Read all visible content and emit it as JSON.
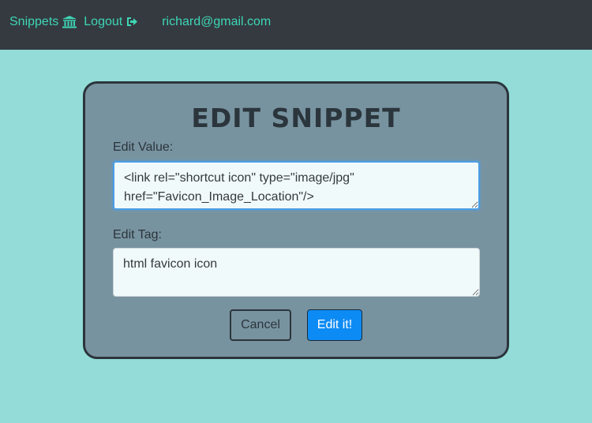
{
  "nav": {
    "snippets_label": "Snippets",
    "snippets_icon": "bank-icon",
    "logout_label": "Logout",
    "logout_icon": "sign-out-icon",
    "user_email": "richard@gmail.com"
  },
  "form": {
    "title": "EDIT SNIPPET",
    "value_label": "Edit Value:",
    "value_text": "<link rel=\"shortcut icon\" type=\"image/jpg\" href=\"Favicon_Image_Location\"/>",
    "tag_label": "Edit Tag:",
    "tag_text": "html favicon icon",
    "cancel_label": "Cancel",
    "submit_label": "Edit it!"
  },
  "colors": {
    "page_background": "#93dcd8",
    "navbar": "#343a40",
    "nav_link": "#3fd6b6",
    "card": "#7893a0",
    "primary_button": "#0d8bf5"
  }
}
